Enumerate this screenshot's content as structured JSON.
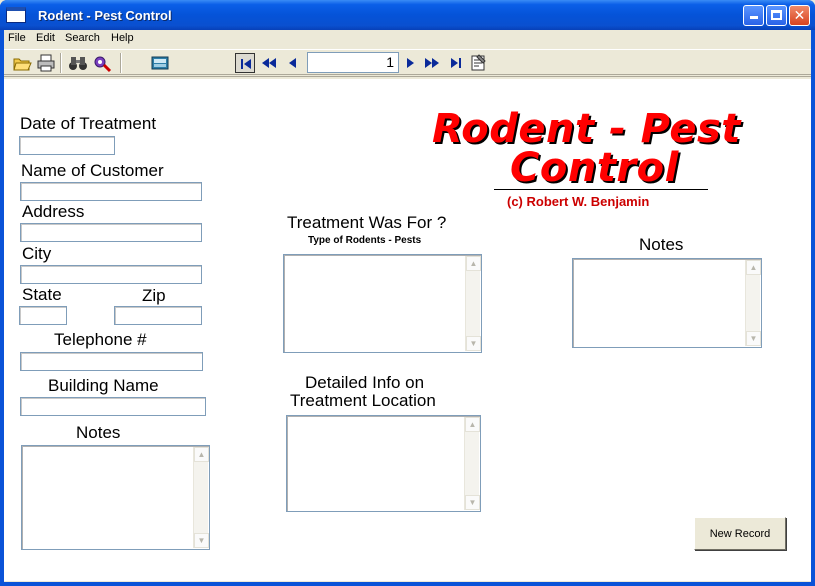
{
  "window": {
    "title": "Rodent - Pest Control",
    "minimize_glyph": "",
    "maximize_glyph": "",
    "close_glyph": "✕"
  },
  "menu": {
    "items": [
      {
        "label": "File"
      },
      {
        "label": "Edit"
      },
      {
        "label": "Search"
      },
      {
        "label": "Help"
      }
    ]
  },
  "toolbar": {
    "icons": [
      "open-folder-icon",
      "print-icon",
      "binoculars-icon",
      "find-replace-icon",
      "calculator-icon"
    ],
    "nav": [
      "first-record-icon",
      "rewind-icon",
      "previous-record-icon",
      "next-record-icon",
      "fast-forward-icon",
      "last-record-icon",
      "properties-icon"
    ],
    "record_number": "1"
  },
  "logo": {
    "line1": "Rodent - Pest",
    "line2": "Control",
    "credit": "(c) Robert W. Benjamin"
  },
  "form": {
    "date_label": "Date of Treatment",
    "customer_label": "Name of Customer",
    "address_label": "Address",
    "city_label": "City",
    "state_label": "State",
    "zip_label": "Zip",
    "phone_label": "Telephone #",
    "building_label": "Building Name",
    "notes_left_label": "Notes",
    "treatment_label": "Treatment Was For ?",
    "treatment_sub": "Type of Rodents - Pests",
    "location_label_line1": "Detailed Info on",
    "location_label_line2": "Treatment Location",
    "notes_right_label": "Notes",
    "values": {
      "date": "",
      "customer": "",
      "address": "",
      "city": "",
      "state": "",
      "zip": "",
      "phone": "",
      "building": "",
      "notes_left": "",
      "treatment": "",
      "location": "",
      "notes_right": ""
    },
    "new_record_label": "New Record"
  },
  "colors": {
    "titlebar": "#0553d8",
    "logo_red": "#ff0000",
    "credit_red": "#cc0000",
    "face": "#ece9d8"
  }
}
